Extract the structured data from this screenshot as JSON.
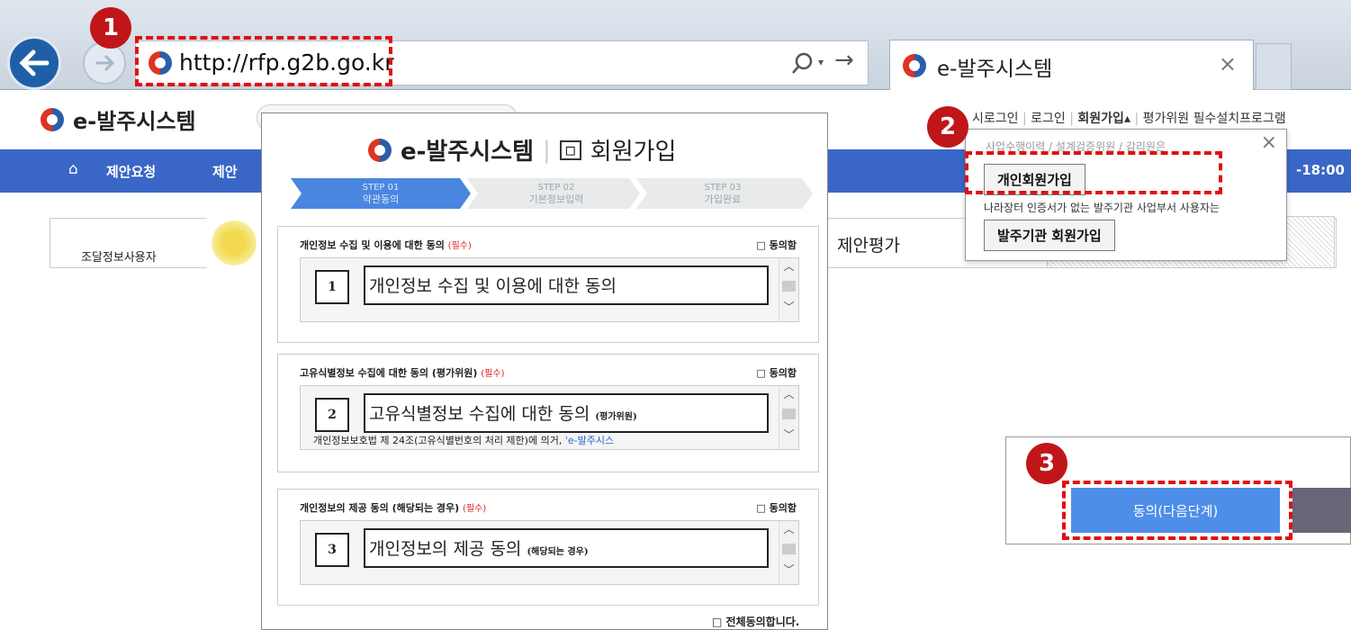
{
  "browser": {
    "url": "http://rfp.g2b.go.kr",
    "tab_title": "e-발주시스템",
    "tab_close": "×"
  },
  "callouts": [
    "1",
    "2",
    "3"
  ],
  "site": {
    "title": "e-발주시스템",
    "top_links": [
      "시로그인",
      "로그인",
      "회원가입▴",
      "평가위원 필수설치프로그램"
    ],
    "nav": [
      "제안요청",
      "제안"
    ],
    "hours": "-18:00",
    "left_label": "조달정보사용자",
    "mid_label": "제안평가"
  },
  "dropdown": {
    "faded_line": "사업수행이력 / 설계검증위원 / 감리원은",
    "personal_join": "개인회원가입",
    "note": "나라장터 인증서가 없는 발주기관 사업부서 사용자는",
    "agency_join": "발주기관 회원가입",
    "close": "×"
  },
  "modal": {
    "brand": "e-발주시스템",
    "page": "회원가입",
    "steps": [
      {
        "num": "STEP 01",
        "label": "약관동의"
      },
      {
        "num": "STEP 02",
        "label": "기본정보입력"
      },
      {
        "num": "STEP 03",
        "label": "가입완료"
      }
    ],
    "sections": [
      {
        "title": "개인정보 수집 및 이용에 대한 동의",
        "req": "(필수)",
        "agree": "□ 동의함",
        "num": "1",
        "term": "개인정보 수집 및 이용에 대한 동의",
        "term_small": "",
        "extra": ""
      },
      {
        "title": "고유식별정보 수집에 대한 동의 (평가위원)",
        "req": "(필수)",
        "agree": "□ 동의함",
        "num": "2",
        "term": "고유식별정보 수집에 대한 동의",
        "term_small": "(평가위원)",
        "extra": "개인정보보호법 제 24조(고유식별번호의 처리 제한)에 의거, ",
        "extra_link": "'e-발주시스"
      },
      {
        "title": "개인정보의 제공 동의 (해당되는 경우)",
        "req": "(필수)",
        "agree": "□ 동의함",
        "num": "3",
        "term": "개인정보의 제공 동의",
        "term_small": "(해당되는 경우)",
        "extra": ""
      }
    ],
    "all_agree": "□ 전체동의합니다."
  },
  "next_button": "동의(다음단계)"
}
